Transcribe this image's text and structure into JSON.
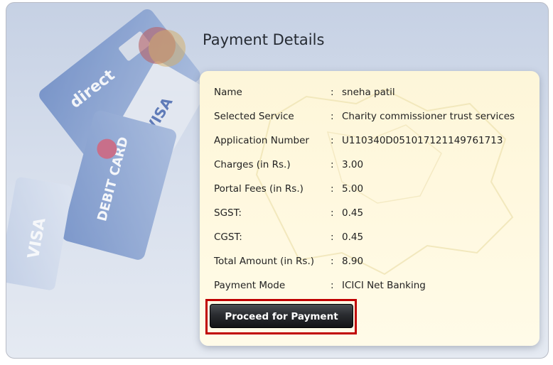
{
  "panel": {
    "title": "Payment Details"
  },
  "details": [
    {
      "label": "Name",
      "value": "sneha patil"
    },
    {
      "label": "Selected Service",
      "value": "Charity commissioner trust services"
    },
    {
      "label": "Application Number",
      "value": "U110340D051017121149761713"
    },
    {
      "label": "Charges (in Rs.)",
      "value": "3.00"
    },
    {
      "label": "Portal Fees (in Rs.)",
      "value": "5.00"
    },
    {
      "label": "SGST:",
      "value": "0.45"
    },
    {
      "label": "CGST:",
      "value": "0.45"
    },
    {
      "label": "Total Amount (in Rs.)",
      "value": "8.90"
    },
    {
      "label": "Payment Mode",
      "value": "ICICI Net Banking"
    }
  ],
  "separator": ":",
  "action": {
    "label": "Proceed for Payment"
  },
  "card_art": {
    "brand_texts": [
      "VISA",
      "DEBIT CARD",
      "VISA",
      "direct"
    ]
  },
  "colors": {
    "highlight": "#c00000",
    "panel_bg": "#fff8de",
    "button_bg": "#1f2023"
  }
}
